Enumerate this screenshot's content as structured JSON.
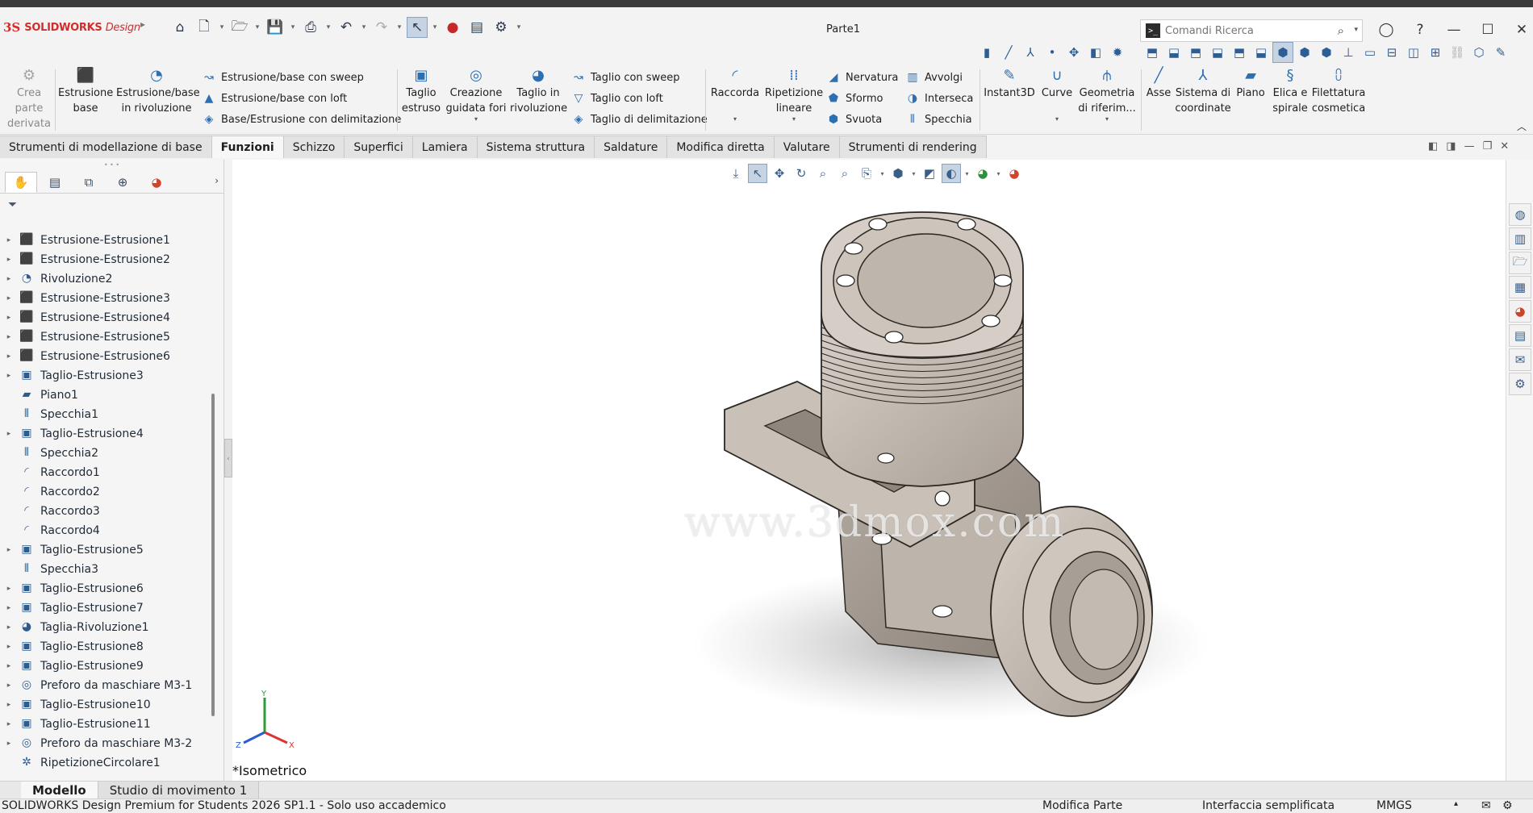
{
  "app": {
    "brand_ds": "3S",
    "brand": "SOLIDWORKS",
    "brand_suffix": "Design",
    "doc_title": "Parte1"
  },
  "search": {
    "placeholder": "Comandi Ricerca"
  },
  "ribbon": {
    "crea_parte_derivata": [
      "Crea",
      "parte",
      "derivata"
    ],
    "estrusione_base": [
      "Estrusione",
      "base"
    ],
    "estrusione_rivoluzione": [
      "Estrusione/base",
      "in rivoluzione"
    ],
    "sweep_base": "Estrusione/base con sweep",
    "loft_base": "Estrusione/base con loft",
    "delimitazione_base": "Base/Estrusione con delimitazione",
    "taglio_estruso": [
      "Taglio",
      "estruso"
    ],
    "creazione_fori": [
      "Creazione",
      "guidata fori"
    ],
    "taglio_rivoluzione": [
      "Taglio in",
      "rivoluzione"
    ],
    "taglio_sweep": "Taglio con sweep",
    "taglio_loft": "Taglio con loft",
    "taglio_delimitazione": "Taglio di delimitazione",
    "raccorda": "Raccorda",
    "ripetizione_lineare": [
      "Ripetizione",
      "lineare"
    ],
    "nervatura": "Nervatura",
    "sformo": "Sformo",
    "svuota": "Svuota",
    "avvolgi": "Avvolgi",
    "interseca": "Interseca",
    "specchia": "Specchia",
    "instant3d": "Instant3D",
    "curve": "Curve",
    "geometria_riferimento": [
      "Geometria",
      "di riferim..."
    ],
    "asse": "Asse",
    "sistema_coordinate": [
      "Sistema di",
      "coordinate"
    ],
    "piano": "Piano",
    "elica_spirale": [
      "Elica e",
      "spirale"
    ],
    "filettatura_cosmetica": [
      "Filettatura",
      "cosmetica"
    ]
  },
  "tabs": [
    "Strumenti di modellazione di base",
    "Funzioni",
    "Schizzo",
    "Superfici",
    "Lamiera",
    "Sistema struttura",
    "Saldature",
    "Modifica diretta",
    "Valutare",
    "Strumenti di rendering"
  ],
  "tree": [
    {
      "label": "Estrusione-Estrusione1",
      "exp": true,
      "icon": "extrude-icon"
    },
    {
      "label": "Estrusione-Estrusione2",
      "exp": true,
      "icon": "extrude-icon"
    },
    {
      "label": "Rivoluzione2",
      "exp": true,
      "icon": "revolve-icon"
    },
    {
      "label": "Estrusione-Estrusione3",
      "exp": true,
      "icon": "extrude-icon"
    },
    {
      "label": "Estrusione-Estrusione4",
      "exp": true,
      "icon": "extrude-icon"
    },
    {
      "label": "Estrusione-Estrusione5",
      "exp": true,
      "icon": "extrude-icon"
    },
    {
      "label": "Estrusione-Estrusione6",
      "exp": true,
      "icon": "extrude-icon"
    },
    {
      "label": "Taglio-Estrusione3",
      "exp": true,
      "icon": "cut-icon"
    },
    {
      "label": "Piano1",
      "exp": false,
      "icon": "plane-icon"
    },
    {
      "label": "Specchia1",
      "exp": false,
      "icon": "mirror-icon"
    },
    {
      "label": "Taglio-Estrusione4",
      "exp": true,
      "icon": "cut-icon"
    },
    {
      "label": "Specchia2",
      "exp": false,
      "icon": "mirror-icon"
    },
    {
      "label": "Raccordo1",
      "exp": false,
      "icon": "fillet-icon"
    },
    {
      "label": "Raccordo2",
      "exp": false,
      "icon": "fillet-icon"
    },
    {
      "label": "Raccordo3",
      "exp": false,
      "icon": "fillet-icon"
    },
    {
      "label": "Raccordo4",
      "exp": false,
      "icon": "fillet-icon"
    },
    {
      "label": "Taglio-Estrusione5",
      "exp": true,
      "icon": "cut-icon"
    },
    {
      "label": "Specchia3",
      "exp": false,
      "icon": "mirror-icon"
    },
    {
      "label": "Taglio-Estrusione6",
      "exp": true,
      "icon": "cut-icon"
    },
    {
      "label": "Taglio-Estrusione7",
      "exp": true,
      "icon": "cut-icon"
    },
    {
      "label": "Taglia-Rivoluzione1",
      "exp": true,
      "icon": "cut-revolve-icon"
    },
    {
      "label": "Taglio-Estrusione8",
      "exp": true,
      "icon": "cut-icon"
    },
    {
      "label": "Taglio-Estrusione9",
      "exp": true,
      "icon": "cut-icon"
    },
    {
      "label": "Preforo da maschiare M3-1",
      "exp": true,
      "icon": "hole-icon"
    },
    {
      "label": "Taglio-Estrusione10",
      "exp": true,
      "icon": "cut-icon"
    },
    {
      "label": "Taglio-Estrusione11",
      "exp": true,
      "icon": "cut-icon"
    },
    {
      "label": "Preforo da maschiare M3-2",
      "exp": true,
      "icon": "hole-icon"
    },
    {
      "label": "RipetizioneCircolare1",
      "exp": false,
      "icon": "circular-pattern-icon"
    }
  ],
  "viewport": {
    "view_name": "*Isometrico",
    "watermark": "www.3dmox.com",
    "axis_x": "X",
    "axis_y": "Y",
    "axis_z": "Z"
  },
  "bottom_tabs": [
    "Modello",
    "Studio di movimento 1"
  ],
  "status": {
    "product": "SOLIDWORKS Design Premium for Students 2026 SP1.1 - Solo uso accademico",
    "mode": "Modifica Parte",
    "interface": "Interfaccia semplificata",
    "units": "MMGS"
  },
  "colors": {
    "brand_red": "#d22d2d",
    "model_fill": "#c8bfb6",
    "model_edge": "#2b2723",
    "accent_blue": "#2d6fb3"
  }
}
